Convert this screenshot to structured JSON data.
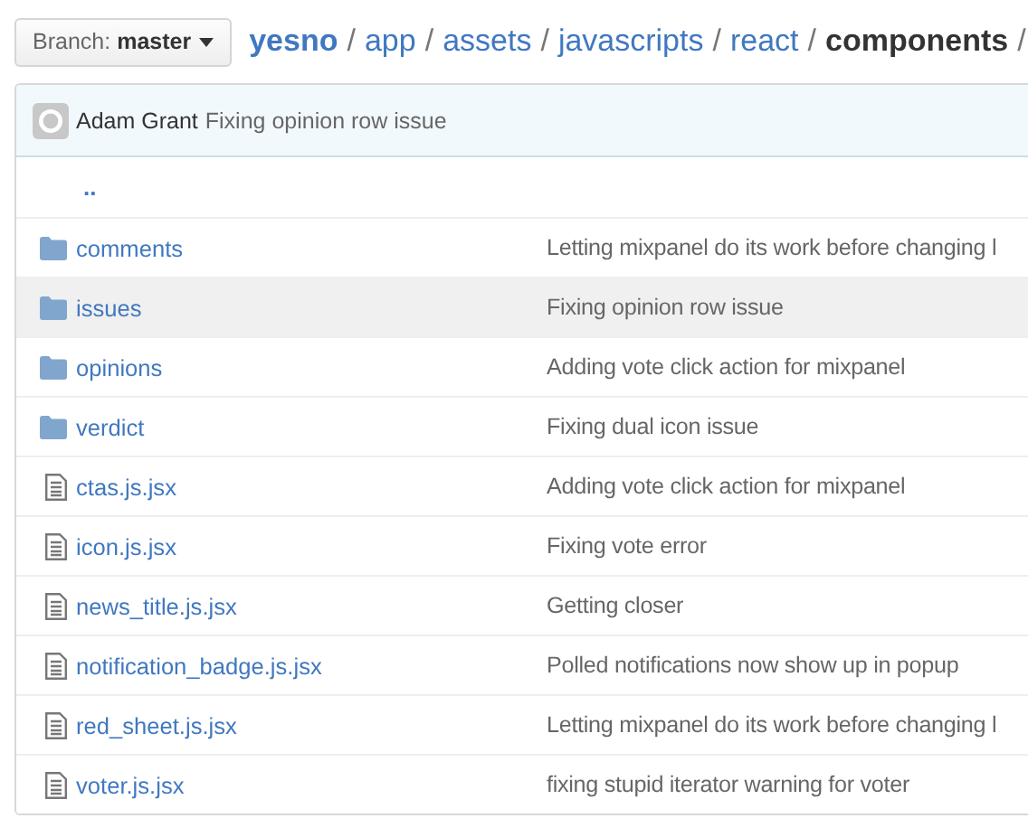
{
  "branch": {
    "label": "Branch:",
    "name": "master"
  },
  "breadcrumb": [
    {
      "text": "yesno",
      "kind": "repo"
    },
    {
      "text": "/",
      "kind": "sep"
    },
    {
      "text": "app",
      "kind": "link"
    },
    {
      "text": "/",
      "kind": "sep"
    },
    {
      "text": "assets",
      "kind": "link"
    },
    {
      "text": "/",
      "kind": "sep"
    },
    {
      "text": "javascripts",
      "kind": "link"
    },
    {
      "text": "/",
      "kind": "sep"
    },
    {
      "text": "react",
      "kind": "link"
    },
    {
      "text": "/",
      "kind": "sep"
    },
    {
      "text": "components",
      "kind": "current"
    },
    {
      "text": "/",
      "kind": "sep"
    }
  ],
  "latest_commit": {
    "author": "Adam Grant",
    "message": "Fixing opinion row issue"
  },
  "parent_link": "..",
  "files": [
    {
      "name": "comments",
      "kind": "folder",
      "message": "Letting mixpanel do its work before changing l",
      "highlighted": false
    },
    {
      "name": "issues",
      "kind": "folder",
      "message": "Fixing opinion row issue",
      "highlighted": true
    },
    {
      "name": "opinions",
      "kind": "folder",
      "message": "Adding vote click action for mixpanel",
      "highlighted": false
    },
    {
      "name": "verdict",
      "kind": "folder",
      "message": "Fixing dual icon issue",
      "highlighted": false
    },
    {
      "name": "ctas.js.jsx",
      "kind": "file",
      "message": "Adding vote click action for mixpanel",
      "highlighted": false
    },
    {
      "name": "icon.js.jsx",
      "kind": "file",
      "message": "Fixing vote error",
      "highlighted": false
    },
    {
      "name": "news_title.js.jsx",
      "kind": "file",
      "message": "Getting closer",
      "highlighted": false
    },
    {
      "name": "notification_badge.js.jsx",
      "kind": "file",
      "message": "Polled notifications now show up in popup",
      "highlighted": false
    },
    {
      "name": "red_sheet.js.jsx",
      "kind": "file",
      "message": "Letting mixpanel do its work before changing l",
      "highlighted": false
    },
    {
      "name": "voter.js.jsx",
      "kind": "file",
      "message": "fixing stupid iterator warning for voter",
      "highlighted": false
    }
  ]
}
